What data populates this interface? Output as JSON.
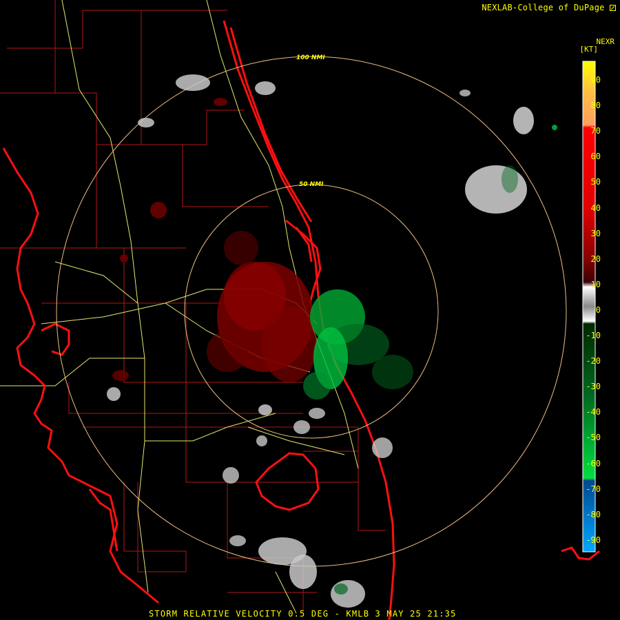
{
  "header": {
    "credit": "NEXLAB-College of DuPage",
    "credit_logo": "cod-logo-icon",
    "product": "NEXR",
    "unit": "[KT]"
  },
  "radar": {
    "station": "KMLB",
    "product_type": "storm relative velocity",
    "range_rings": [
      {
        "label": "50 NMI",
        "value": 50
      },
      {
        "label": "100 NMI",
        "value": 100
      }
    ]
  },
  "legend": {
    "units": "KT",
    "ticks": [
      "90",
      "80",
      "70",
      "60",
      "50",
      "40",
      "30",
      "20",
      "10",
      "0",
      "-10",
      "-20",
      "-30",
      "-40",
      "-50",
      "-60",
      "-70",
      "-80",
      "-90"
    ],
    "colors": {
      "top": "#ffff00",
      "orange": "#ff9f40",
      "red": "#ff0000",
      "dark_red": "#6b0000",
      "near_zero": "#c8c8c8",
      "dark_green": "#004d00",
      "green": "#00e040",
      "blue": "#0060c0",
      "light_blue": "#00a0ff"
    }
  },
  "footer": {
    "caption": "STORM RELATIVE VELOCITY 0.5 DEG - KMLB 3 MAY 25 21:35"
  },
  "map_colors": {
    "coast": "#ff1010",
    "county": "#c01818",
    "roads": "#ffff70",
    "ring": "#f0c080",
    "inbound": "#00b030",
    "outbound": "#8a0000",
    "rf": "#c8c8c8"
  }
}
